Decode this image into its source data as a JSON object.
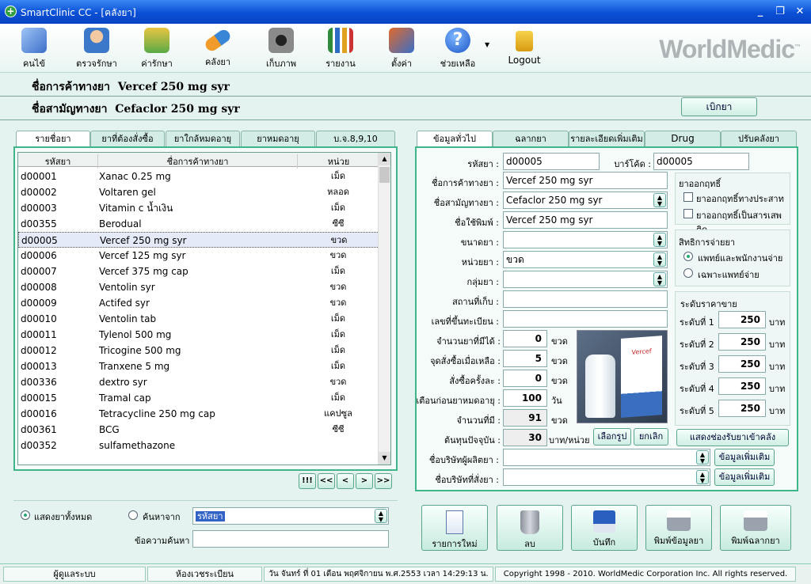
{
  "window": {
    "title": "SmartClinic CC - [คลังยา]",
    "icon": "plus-icon",
    "minimize": "_",
    "restore": "❐",
    "close": "✕"
  },
  "toolbar": {
    "items": [
      {
        "label": "คนไข้",
        "icon": "patient-book-icon"
      },
      {
        "label": "ตรวจรักษา",
        "icon": "doctor-icon"
      },
      {
        "label": "ค่ารักษา",
        "icon": "money-icon"
      },
      {
        "label": "คลังยา",
        "icon": "capsule-icon"
      },
      {
        "label": "เก็บภาพ",
        "icon": "camera-icon"
      },
      {
        "label": "รายงาน",
        "icon": "bar-chart-icon"
      },
      {
        "label": "ตั้งค่า",
        "icon": "tools-icon"
      },
      {
        "label": "ช่วยเหลือ",
        "icon": "help-icon"
      },
      {
        "label": "Logout",
        "icon": "lock-icon"
      }
    ],
    "brand": "WorldMedic",
    "brand_tm": "™"
  },
  "header": {
    "trade_name_label": "ชื่อการค้าทางยา",
    "trade_name": "Vercef 250 mg syr",
    "generic_name_label": "ชื่อสามัญทางยา",
    "generic_name": "Cefaclor 250 mg syr",
    "dispense_button": "เบิกยา"
  },
  "left_tabs": [
    "รายชื่อยา",
    "ยาที่ต้องสั่งซื้อ",
    "ยาใกล้หมดอายุ",
    "ยาหมดอายุ",
    "บ.จ.8,9,10"
  ],
  "drug_list": {
    "columns": [
      "รหัสยา",
      "ชื่อการค้าทางยา",
      "หน่วย"
    ],
    "rows": [
      {
        "code": "d00001",
        "name": "Xanac 0.25 mg",
        "unit": "เม็ด"
      },
      {
        "code": "d00002",
        "name": "Voltaren gel",
        "unit": "หลอด"
      },
      {
        "code": "d00003",
        "name": "Vitamin c น้ำเงิน",
        "unit": "เม็ด"
      },
      {
        "code": "d00355",
        "name": "Berodual",
        "unit": "ซีซี"
      },
      {
        "code": "d00005",
        "name": "Vercef 250 mg syr",
        "unit": "ขวด",
        "selected": true
      },
      {
        "code": "d00006",
        "name": "Vercef 125 mg syr",
        "unit": "ขวด"
      },
      {
        "code": "d00007",
        "name": "Vercef 375 mg cap",
        "unit": "เม็ด"
      },
      {
        "code": "d00008",
        "name": "Ventolin syr",
        "unit": "ขวด"
      },
      {
        "code": "d00009",
        "name": "Actifed syr",
        "unit": "ขวด"
      },
      {
        "code": "d00010",
        "name": "Ventolin tab",
        "unit": "เม็ด"
      },
      {
        "code": "d00011",
        "name": "Tylenol 500 mg",
        "unit": "เม็ด"
      },
      {
        "code": "d00012",
        "name": "Tricogine 500 mg",
        "unit": "เม็ด"
      },
      {
        "code": "d00013",
        "name": "Tranxene 5 mg",
        "unit": "เม็ด"
      },
      {
        "code": "d00336",
        "name": "dextro syr",
        "unit": "ขวด"
      },
      {
        "code": "d00015",
        "name": "Tramal cap",
        "unit": "เม็ด"
      },
      {
        "code": "d00016",
        "name": "Tetracycline 250 mg cap",
        "unit": "แคปซูล"
      },
      {
        "code": "d00361",
        "name": "BCG",
        "unit": "ซีซี"
      },
      {
        "code": "d00352",
        "name": "sulfamethazone",
        "unit": ""
      }
    ]
  },
  "nav": {
    "first": "!!!",
    "prev_page": "<<",
    "prev": "<",
    "next": ">",
    "next_page": ">>"
  },
  "search": {
    "show_all": "แสดงยาทั้งหมด",
    "search_by": "ค้นหาจาก",
    "search_field": "รหัสยา",
    "keyword_label": "ข้อความค้นหา",
    "keyword": ""
  },
  "right_tabs": [
    "ข้อมูลทั่วไป",
    "ฉลากยา",
    "รายละเอียดเพิ่มเติม",
    "Drug Interaction",
    "ปรับคลังยา"
  ],
  "form": {
    "code_label": "รหัสยา :",
    "code": "d00005",
    "barcode_label": "บาร์โค้ด :",
    "barcode": "d00005",
    "trade_label": "ชื่อการค้าทางยา :",
    "trade": "Vercef 250 mg syr",
    "generic_label": "ชื่อสามัญทางยา :",
    "generic": "Cefaclor 250 mg syr",
    "print_label": "ชื่อใช้พิมพ์ :",
    "print_name": "Vercef 250 mg syr",
    "size_label": "ขนาดยา :",
    "size": "",
    "unit_label": "หน่วยยา :",
    "unit": "ขวด",
    "group_label": "กลุ่มยา :",
    "group": "",
    "location_label": "สถานที่เก็บ :",
    "location": "",
    "reg_label": "เลขที่ขึ้นทะเบียน :",
    "reg": "",
    "qty_label": "จำนวนยาที่มีได้ :",
    "qty": "0",
    "qty_unit": "ขวด",
    "reorder_label": "จุดสั่งซื้อเมื่อเหลือ :",
    "reorder": "5",
    "reorder_unit": "ขวด",
    "order_label": "สั่งซื้อครั้งละ :",
    "order": "0",
    "order_unit": "ขวด",
    "expire_label": "เตือนก่อนยาหมดอายุ :",
    "expire": "100",
    "expire_unit": "วัน",
    "stock_label": "จำนวนที่มี :",
    "stock": "91",
    "stock_unit": "ขวด",
    "cost_label": "ต้นทุนปัจจุบัน :",
    "cost": "30",
    "cost_unit": "บาท/หน่วย",
    "maker_label": "ชื่อบริษัทผู้ผลิตยา :",
    "maker": "",
    "more_button": "ข้อมูลเพิ่มเติม",
    "supplier_label": "ชื่อบริษัทที่สั่งยา :",
    "supplier": "",
    "choose_image": "เลือกรูป",
    "cancel_image": "ยกเลิก",
    "show_stock": "แสดงช่องรับยาเข้าคลัง"
  },
  "hazard": {
    "title": "ยาออกฤทธิ์",
    "psycho": "ยาออกฤทธิ์ทางประสาท",
    "narcotic": "ยาออกฤทธิ์เป็นสารเสพติด"
  },
  "rights": {
    "title": "สิทธิการจ่ายยา",
    "opt1": "แพทย์และพนักงานจ่าย",
    "opt2": "เฉพาะแพทย์จ่าย"
  },
  "prices": {
    "title": "ระดับราคาขาย",
    "currency": "บาท",
    "levels": [
      {
        "label": "ระดับที่ 1",
        "value": "250"
      },
      {
        "label": "ระดับที่ 2",
        "value": "250"
      },
      {
        "label": "ระดับที่ 3",
        "value": "250"
      },
      {
        "label": "ระดับที่ 4",
        "value": "250"
      },
      {
        "label": "ระดับที่ 5",
        "value": "250"
      }
    ]
  },
  "product_image": {
    "brand": "Vercef"
  },
  "actions": [
    {
      "label": "รายการใหม่",
      "icon": "new-document-icon"
    },
    {
      "label": "ลบ",
      "icon": "trash-icon"
    },
    {
      "label": "บันทึก",
      "icon": "save-disk-icon"
    },
    {
      "label": "พิมพ์ข้อมูลยา",
      "icon": "printer-icon"
    },
    {
      "label": "พิมพ์ฉลากยา",
      "icon": "printer-icon"
    }
  ],
  "status": {
    "user": "ผู้ดูแลระบบ",
    "room": "ห้องเวชระเบียน",
    "datetime": "วัน จันทร์ ที่ 01 เดือน พฤศจิกายน พ.ศ.2553 เวลา 14:29:13 น.",
    "copyright": "Copyright 1998 - 2010. WorldMedic Corporation Inc. All rights reserved."
  },
  "colors": {
    "titlebar": "#0a4fd6",
    "background": "#e4f3ef",
    "accent": "#5aa58a"
  }
}
